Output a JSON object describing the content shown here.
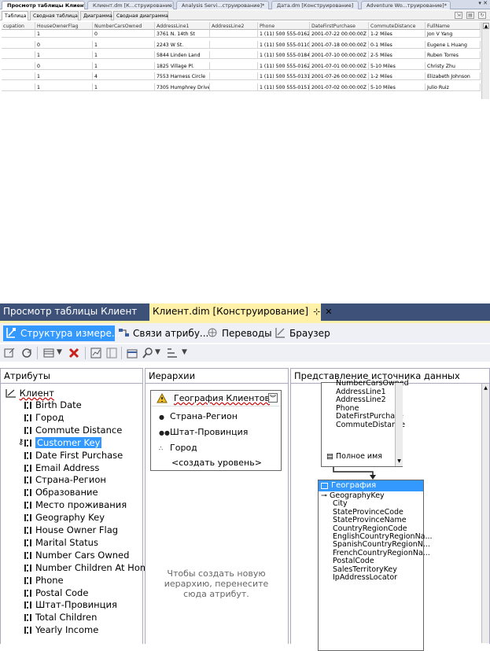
{
  "top": {
    "doc_tabs": [
      "Просмотр таблицы Клиент",
      "Клиент.dm [К...струирование]*",
      "Analysis Servi...струирование]*",
      "Дата.dm [Конструирование]",
      "Adventure Wo...труирование]*"
    ],
    "controls": "▾ ✕",
    "view_tabs": [
      "Таблица",
      "Сводная таблица",
      "Диаграмма",
      "Сводная диаграмма"
    ],
    "grid": {
      "columns": [
        "cupation",
        "HouseOwnerFlag",
        "NumberCarsOwned",
        "AddressLine1",
        "AddressLine2",
        "Phone",
        "DateFirstPurchase",
        "CommuteDistance",
        "FullName"
      ],
      "rows": [
        [
          "",
          "1",
          "0",
          "3761 N. 14th St",
          "",
          "1 (11) 500 555-0162",
          "2001-07-22 00:00:00Z",
          "1-2 Miles",
          "Jon V Yang"
        ],
        [
          "",
          "0",
          "1",
          "2243 W St.",
          "",
          "1 (11) 500 555-0110",
          "2001-07-18 00:00:00Z",
          "0-1 Miles",
          "Eugene L Huang"
        ],
        [
          "",
          "1",
          "1",
          "5844 Linden Land",
          "",
          "1 (11) 500 555-0184",
          "2001-07-10 00:00:00Z",
          "2-5 Miles",
          "Ruben Torres"
        ],
        [
          "",
          "0",
          "1",
          "1825 Village Pl.",
          "",
          "1 (11) 500 555-0162",
          "2001-07-01 00:00:00Z",
          "5-10 Miles",
          "Christy Zhu"
        ],
        [
          "",
          "1",
          "4",
          "7553 Harness Circle",
          "",
          "1 (11) 500 555-0131",
          "2001-07-26 00:00:00Z",
          "1-2 Miles",
          "Elizabeth Johnson"
        ],
        [
          "",
          "1",
          "1",
          "7305 Humphrey Drive",
          "",
          "1 (11) 500 555-0151",
          "2001-07-02 00:00:00Z",
          "5-10 Miles",
          "Julio Ruiz"
        ]
      ]
    }
  },
  "bottom": {
    "tabs": [
      "Просмотр таблицы Клиент",
      "Клиент.dim [Конструирование]"
    ],
    "pin": "⊹",
    "close": "✕",
    "subtabs": [
      "Структура измере...",
      "Связи атрибу...",
      "Переводы",
      "Браузер"
    ],
    "panels": {
      "attributes": "Атрибуты",
      "hierarchies": "Иерархии",
      "dsv": "Представление источника данных"
    },
    "attr_root": "Клиент",
    "attributes": [
      "Birth Date",
      "Город",
      "Commute Distance",
      "Customer Key",
      "Date First Purchase",
      "Email Address",
      "Страна-Регион",
      "Образование",
      "Место проживания",
      "Geography Key",
      "House Owner Flag",
      "Marital Status",
      "Number Cars Owned",
      "Number Children At Home",
      "Phone",
      "Postal Code",
      "Штат-Провинция",
      "Total Children",
      "Yearly Income"
    ],
    "selected_attribute": "Customer Key",
    "hierarchy": {
      "name": "География Клиентов",
      "levels": [
        "Страна-Регион",
        "Штат-Провинция",
        "Город"
      ],
      "new_level": "<создать уровень>",
      "hint": "Чтобы создать новую иерархию, перенесите сюда атрибут."
    },
    "table1_columns": [
      "NumberCarsOwned",
      "AddressLine1",
      "AddressLine2",
      "Phone",
      "DateFirstPurchase",
      "CommuteDistance"
    ],
    "table1_special": "Полное имя",
    "table2": {
      "name": "География",
      "columns": [
        "GeographyKey",
        "City",
        "StateProvinceCode",
        "StateProvinceName",
        "CountryRegionCode",
        "EnglishCountryRegionNa...",
        "SpanishCountryRegionN...",
        "FrenchCountryRegionNa...",
        "PostalCode",
        "SalesTerritoryKey",
        "IpAddressLocator"
      ]
    }
  }
}
